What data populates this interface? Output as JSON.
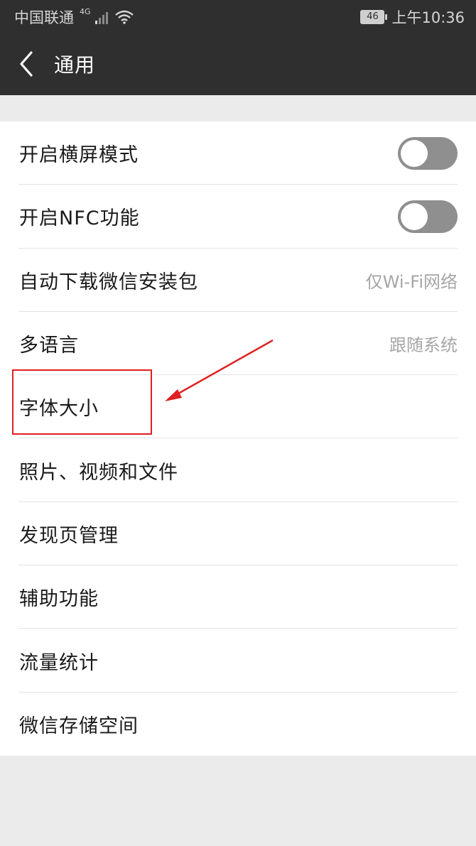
{
  "status_bar": {
    "carrier": "中国联通",
    "network": "4G",
    "battery": "46",
    "time": "上午10:36"
  },
  "title_bar": {
    "title": "通用"
  },
  "settings": {
    "items": [
      {
        "label": "开启横屏模式",
        "toggle": "off"
      },
      {
        "label": "开启NFC功能",
        "toggle": "off"
      },
      {
        "label": "自动下载微信安装包",
        "value": "仅Wi-Fi网络"
      },
      {
        "label": "多语言",
        "value": "跟随系统"
      },
      {
        "label": "字体大小"
      },
      {
        "label": "照片、视频和文件"
      },
      {
        "label": "发现页管理"
      },
      {
        "label": "辅助功能"
      },
      {
        "label": "流量统计"
      },
      {
        "label": "微信存储空间"
      }
    ]
  },
  "colors": {
    "bar_background": "#2f2f2f",
    "page_background": "#ebebeb",
    "annotation": "#e02020",
    "toggle_off": "#8f8f8f"
  }
}
